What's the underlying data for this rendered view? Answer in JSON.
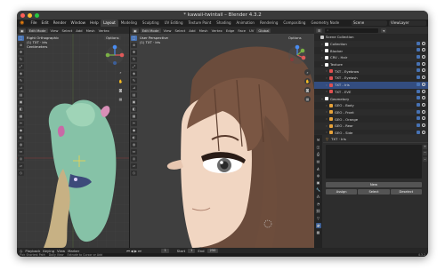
{
  "window": {
    "title": "* kawaii-twintail – Blender 4.3.2",
    "traffic_colors": [
      "#ff5f57",
      "#febc2e",
      "#28c840"
    ]
  },
  "menu": {
    "items": [
      "File",
      "Edit",
      "Render",
      "Window",
      "Help"
    ],
    "tabs": [
      "Layout",
      "Modeling",
      "Sculpting",
      "UV Editing",
      "Texture Paint",
      "Shading",
      "Animation",
      "Rendering",
      "Compositing",
      "Geometry Node"
    ],
    "active_tab": "Layout",
    "scene": "Scene",
    "view_layer": "ViewLayer"
  },
  "left_viewport": {
    "mode": "Edit Mode",
    "menus": [
      "View",
      "Select",
      "Add",
      "Mesh"
    ],
    "extra": "Vertex",
    "overlay": "Options",
    "info_line1": "Right Orthographic",
    "info_line2": "(1) TXT · Iris",
    "info_line3": "Centimeters"
  },
  "mid_viewport": {
    "mode": "Edit Mode",
    "menus": [
      "View",
      "Select",
      "Add",
      "Mesh",
      "Vertex",
      "Edge",
      "Face",
      "UV"
    ],
    "transform": "Global",
    "overlay": "Options",
    "info_line1": "User Perspective",
    "info_line2": "(1) TXT · Iris"
  },
  "outliner": {
    "search_placeholder": "",
    "rows": [
      {
        "label": "Scene Collection",
        "indent": 0,
        "color": "#cfcfcf",
        "tri": ""
      },
      {
        "label": "Collection",
        "indent": 1,
        "color": "#ffffff",
        "tri": "›"
      },
      {
        "label": "Blocker",
        "indent": 1,
        "color": "#ffffff",
        "tri": "›"
      },
      {
        "label": "CRV - Hair",
        "indent": 1,
        "color": "#ffffff",
        "tri": "›"
      },
      {
        "label": "Texture",
        "indent": 1,
        "color": "#ffffff",
        "tri": "⌄"
      },
      {
        "label": "TXT - Eyebrow",
        "indent": 2,
        "color": "#e05050",
        "tri": "›"
      },
      {
        "label": "TXT - Eyelash",
        "indent": 2,
        "color": "#e05050",
        "tri": "›"
      },
      {
        "label": "TXT - Iris",
        "indent": 2,
        "color": "#e05050",
        "tri": "›",
        "selected": true
      },
      {
        "label": "TXT - EVE",
        "indent": 2,
        "color": "#e05050",
        "tri": "›"
      },
      {
        "label": "Geometory",
        "indent": 1,
        "color": "#ffffff",
        "tri": "⌄"
      },
      {
        "label": "GEO - Body",
        "indent": 2,
        "color": "#e7a23a",
        "tri": "›"
      },
      {
        "label": "GEO - Front",
        "indent": 2,
        "color": "#e7a23a",
        "tri": "›"
      },
      {
        "label": "GEO - Orange",
        "indent": 2,
        "color": "#e7a23a",
        "tri": "›"
      },
      {
        "label": "GEO - Rear",
        "indent": 2,
        "color": "#e7a23a",
        "tri": "›"
      },
      {
        "label": "GEO - Side",
        "indent": 2,
        "color": "#e7a23a",
        "tri": "›"
      }
    ]
  },
  "properties": {
    "object_path": "TXT · Iris",
    "new_label": "New",
    "assign": "Assign",
    "select": "Select",
    "deselect": "Deselect"
  },
  "timeline": {
    "playback": "Playback",
    "keying": "Keying",
    "view": "View",
    "marker": "Marker",
    "current_frame": "1",
    "start_label": "Start",
    "start": "1",
    "end_label": "End",
    "end": "250"
  },
  "status": {
    "items": [
      "Pick Shortest Path",
      "Dolly View",
      "Extrude to Cursor or Add"
    ],
    "version": "4.3.2"
  }
}
